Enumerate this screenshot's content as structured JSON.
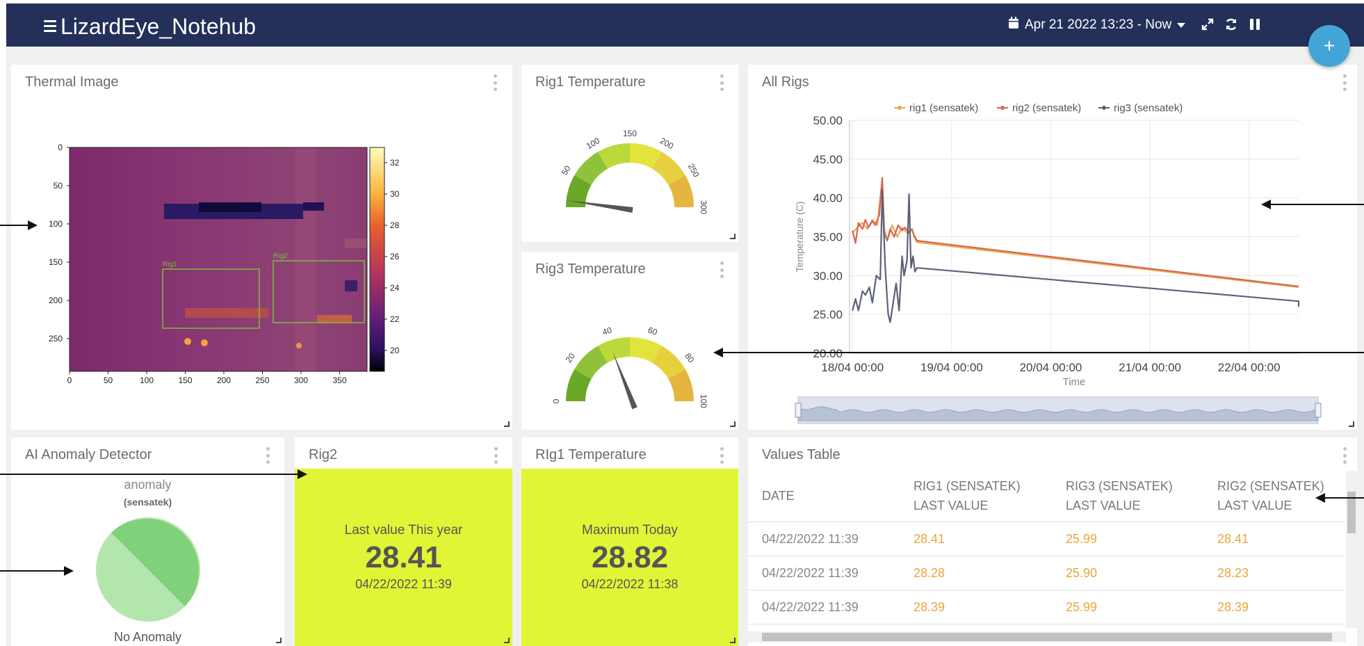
{
  "app": {
    "title": "LizardEye_Notehub"
  },
  "toolbar": {
    "date_range": "Apr 21 2022 13:23 - Now",
    "fab_label": "+"
  },
  "panels": {
    "thermal": {
      "title": "Thermal Image",
      "y_ticks": [
        "0",
        "50",
        "100",
        "150",
        "200",
        "250"
      ],
      "x_ticks": [
        "0",
        "50",
        "100",
        "150",
        "200",
        "250",
        "300",
        "350"
      ],
      "colorbar_ticks": [
        "32",
        "30",
        "28",
        "26",
        "24",
        "22",
        "20"
      ],
      "box1": "Rig1",
      "box2": "Rig2"
    },
    "rig1_gauge": {
      "title": "Rig1 Temperature",
      "ticks": [
        "50",
        "100",
        "150",
        "200",
        "250",
        "300"
      ],
      "value": 0
    },
    "rig3_gauge": {
      "title": "Rig3 Temperature",
      "ticks": [
        "0",
        "20",
        "40",
        "60",
        "80",
        "100"
      ],
      "value": 26
    },
    "all_rigs": {
      "title": "All Rigs"
    },
    "anomaly": {
      "title": "AI Anomaly Detector",
      "label": "anomaly",
      "sublabel": "(sensatek)",
      "footer": "No Anomaly"
    },
    "rig2_stat": {
      "title": "Rig2",
      "label": "Last value This year",
      "value": "28.41",
      "date": "04/22/2022 11:39"
    },
    "rig1_stat": {
      "title": "RIg1 Temperature",
      "label": "Maximum Today",
      "value": "28.82",
      "date": "04/22/2022 11:38"
    },
    "values_table": {
      "title": "Values Table",
      "headers": [
        {
          "line1": "DATE",
          "line2": ""
        },
        {
          "line1": "RIG1 (SENSATEK)",
          "line2": "LAST VALUE"
        },
        {
          "line1": "RIG3 (SENSATEK)",
          "line2": "LAST VALUE"
        },
        {
          "line1": "RIG2 (SENSATEK)",
          "line2": "LAST VALUE"
        }
      ],
      "rows": [
        [
          "04/22/2022 11:39",
          "28.41",
          "25.99",
          "28.41"
        ],
        [
          "04/22/2022 11:39",
          "28.28",
          "25.90",
          "28.23"
        ],
        [
          "04/22/2022 11:39",
          "28.39",
          "25.99",
          "28.39"
        ]
      ]
    }
  },
  "chart_data": {
    "type": "line",
    "title": "",
    "xlabel": "Time",
    "ylabel": "Temperature (C)",
    "ylim": [
      20,
      50
    ],
    "y_ticks": [
      "50.00",
      "45.00",
      "40.00",
      "35.00",
      "30.00",
      "25.00",
      "20.00"
    ],
    "x_ticks": [
      "18/04 00:00",
      "19/04 00:00",
      "20/04 00:00",
      "21/04 00:00",
      "22/04 00:00"
    ],
    "legend_position": "top",
    "grid": true,
    "series": [
      {
        "name": "rig1  (sensatek)",
        "color": "#f0a742",
        "x": [
          0.0,
          0.05,
          0.1,
          0.15,
          0.2,
          0.25,
          0.3,
          0.32,
          0.35,
          0.4,
          0.45,
          0.5,
          0.55,
          0.6,
          0.62,
          0.65,
          4.5
        ],
        "y": [
          35.5,
          36.2,
          36.8,
          36.0,
          37.2,
          36.5,
          42.5,
          36.0,
          34.5,
          36.5,
          35.0,
          36.2,
          35.5,
          36.0,
          35.0,
          34.3,
          28.5
        ]
      },
      {
        "name": "rig2  (sensatek)",
        "color": "#d0695a",
        "x": [
          0.0,
          0.03,
          0.06,
          0.1,
          0.13,
          0.16,
          0.2,
          0.23,
          0.27,
          0.3,
          0.32,
          0.35,
          0.38,
          0.42,
          0.46,
          0.5,
          0.53,
          0.57,
          0.6,
          0.62,
          0.65,
          4.5
        ],
        "y": [
          35.8,
          34.2,
          36.8,
          36.0,
          37.2,
          36.2,
          37.0,
          36.5,
          37.8,
          42.6,
          35.5,
          34.5,
          36.0,
          35.0,
          36.5,
          35.8,
          36.2,
          35.5,
          36.0,
          35.2,
          34.5,
          28.6
        ]
      },
      {
        "name": "rig3  (sensatek)",
        "color": "#5b6178",
        "x": [
          0.0,
          0.03,
          0.06,
          0.1,
          0.13,
          0.17,
          0.2,
          0.24,
          0.28,
          0.3,
          0.33,
          0.36,
          0.38,
          0.41,
          0.44,
          0.47,
          0.5,
          0.52,
          0.55,
          0.57,
          0.59,
          0.61,
          0.63,
          0.65,
          4.5,
          4.5
        ],
        "y": [
          25.5,
          27.0,
          25.5,
          28.0,
          27.5,
          28.5,
          26.5,
          30.0,
          29.5,
          41.0,
          31.0,
          25.0,
          24.0,
          26.5,
          29.0,
          25.5,
          32.5,
          30.0,
          32.0,
          40.5,
          31.0,
          32.5,
          30.5,
          31.0,
          26.7,
          26.0
        ]
      }
    ]
  }
}
